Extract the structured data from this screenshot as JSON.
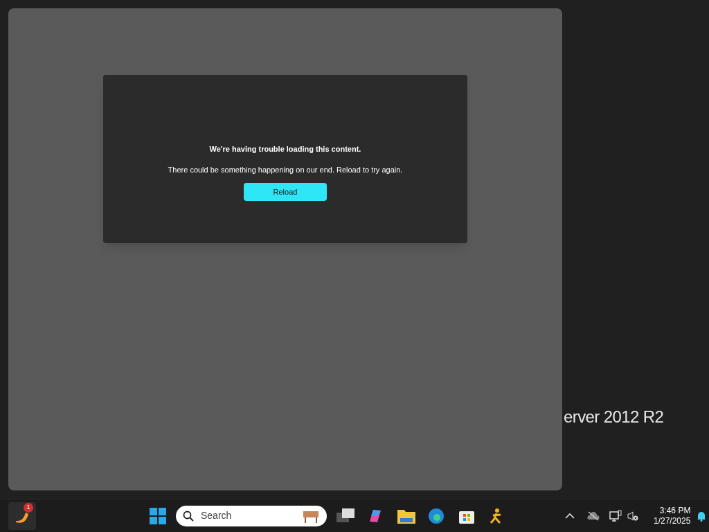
{
  "desktop": {
    "watermark_text": "erver 2012 R2"
  },
  "window": {
    "error": {
      "title": "We're having trouble loading this content.",
      "message": "There could be something happening on our end. Reload to try again.",
      "button": "Reload"
    }
  },
  "taskbar": {
    "app_badge": "1",
    "search_placeholder": "Search",
    "clock": {
      "time": "3:46 PM",
      "date": "1/27/2025"
    }
  }
}
